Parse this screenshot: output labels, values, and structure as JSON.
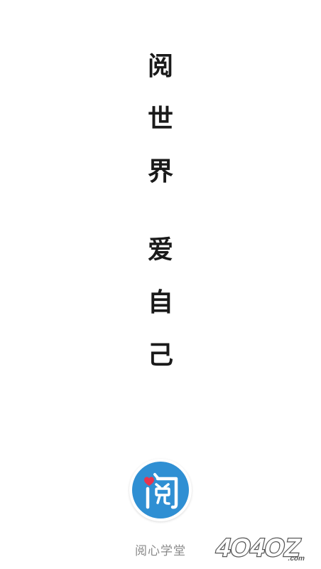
{
  "slogan": {
    "line1": [
      "阅",
      "世",
      "界"
    ],
    "line2": [
      "爱",
      "自",
      "己"
    ]
  },
  "logo": {
    "glyph": "阅",
    "background_color": "#2f8fd3",
    "heart_color": "#e8344e"
  },
  "app_name": "阅心学堂",
  "watermark": {
    "text": "4O4OZ",
    "suffix": ".com"
  }
}
